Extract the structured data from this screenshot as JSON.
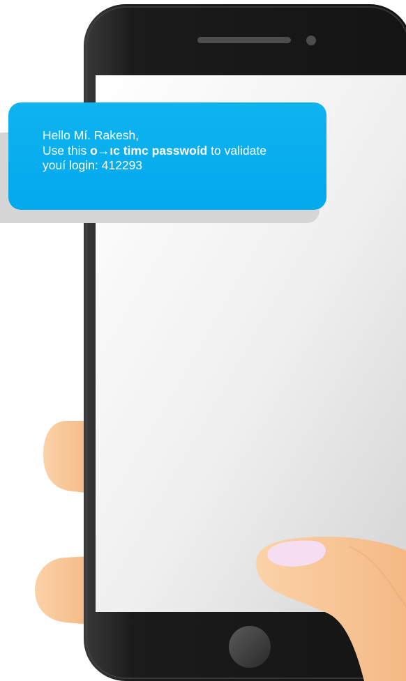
{
  "message": {
    "greeting": "Hello Mí. Rakesh,",
    "line2_prefix": "Use this ",
    "line2_bold": "o→ıc timc passwoíd",
    "line2_suffix": " to validate",
    "line3": "youí login: 412293"
  },
  "colors": {
    "bubble": "#05aaec",
    "phone_body": "#1e1e1e",
    "screen": "#f0f0f0",
    "skin": "#f9c79a",
    "fingernail": "#f5def2"
  },
  "icons": {
    "speaker": "speaker-grille-icon",
    "camera": "front-camera-icon",
    "home": "home-button-icon"
  }
}
